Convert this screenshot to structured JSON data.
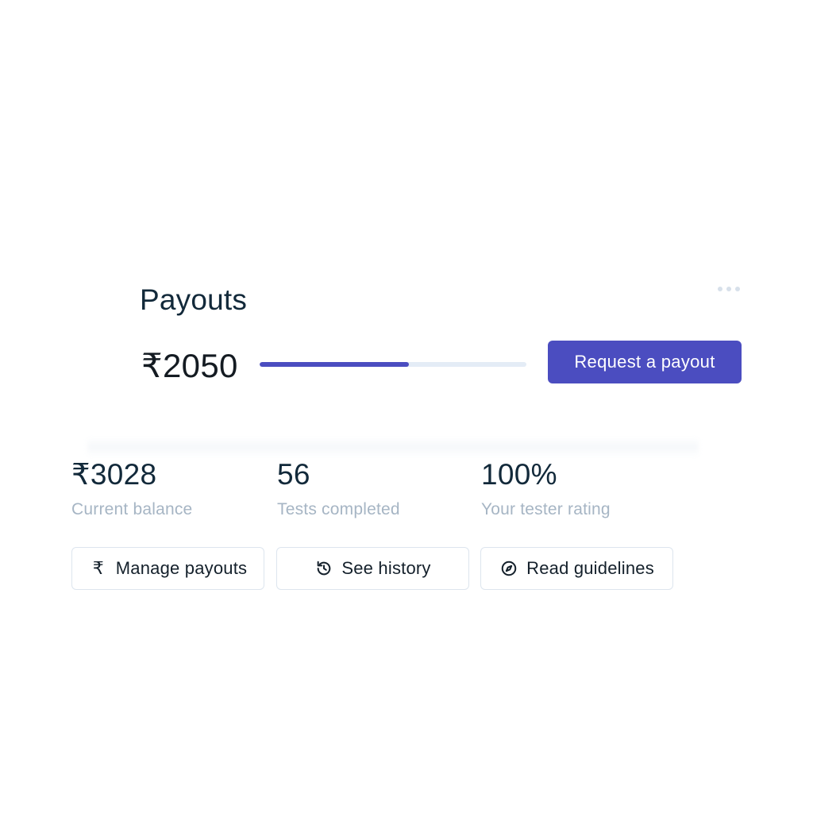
{
  "card": {
    "title": "Payouts",
    "amount": "₹2050",
    "progress_fraction": 0.56,
    "request_button_label": "Request a payout"
  },
  "stats": [
    {
      "value": "₹3028",
      "label": "Current balance"
    },
    {
      "value": "56",
      "label": "Tests completed"
    },
    {
      "value": "100%",
      "label": "Your tester rating"
    }
  ],
  "actions": [
    {
      "label": "Manage payouts",
      "icon": "rupee-icon"
    },
    {
      "label": "See history",
      "icon": "history-icon"
    },
    {
      "label": "Read guidelines",
      "icon": "compass-icon"
    }
  ],
  "icons": {
    "manage": "₹"
  },
  "colors": {
    "accent": "#4b4dc0",
    "progress_track": "#e4ecf6",
    "muted_text": "#a6b5c4",
    "border": "#dde5ee"
  }
}
